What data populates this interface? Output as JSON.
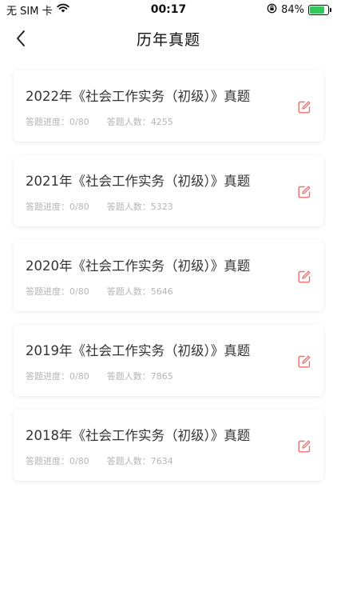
{
  "status": {
    "carrier": "无 SIM 卡",
    "time": "00:17",
    "battery_pct": "84%",
    "battery_level": 0.84
  },
  "nav": {
    "title": "历年真题"
  },
  "colors": {
    "accent": "#ef6f6c",
    "meta_text": "#b5b5b5"
  },
  "exams": [
    {
      "title": "2022年《社会工作实务（初级）》真题",
      "progress_label": "答题进度：0/80",
      "count_label": "答题人数：4255"
    },
    {
      "title": "2021年《社会工作实务（初级）》真题",
      "progress_label": "答题进度：0/80",
      "count_label": "答题人数：5323"
    },
    {
      "title": "2020年《社会工作实务（初级）》真题",
      "progress_label": "答题进度：0/80",
      "count_label": "答题人数：5646"
    },
    {
      "title": "2019年《社会工作实务（初级）》真题",
      "progress_label": "答题进度：0/80",
      "count_label": "答题人数：7865"
    },
    {
      "title": "2018年《社会工作实务（初级）》真题",
      "progress_label": "答题进度：0/80",
      "count_label": "答题人数：7634"
    }
  ]
}
